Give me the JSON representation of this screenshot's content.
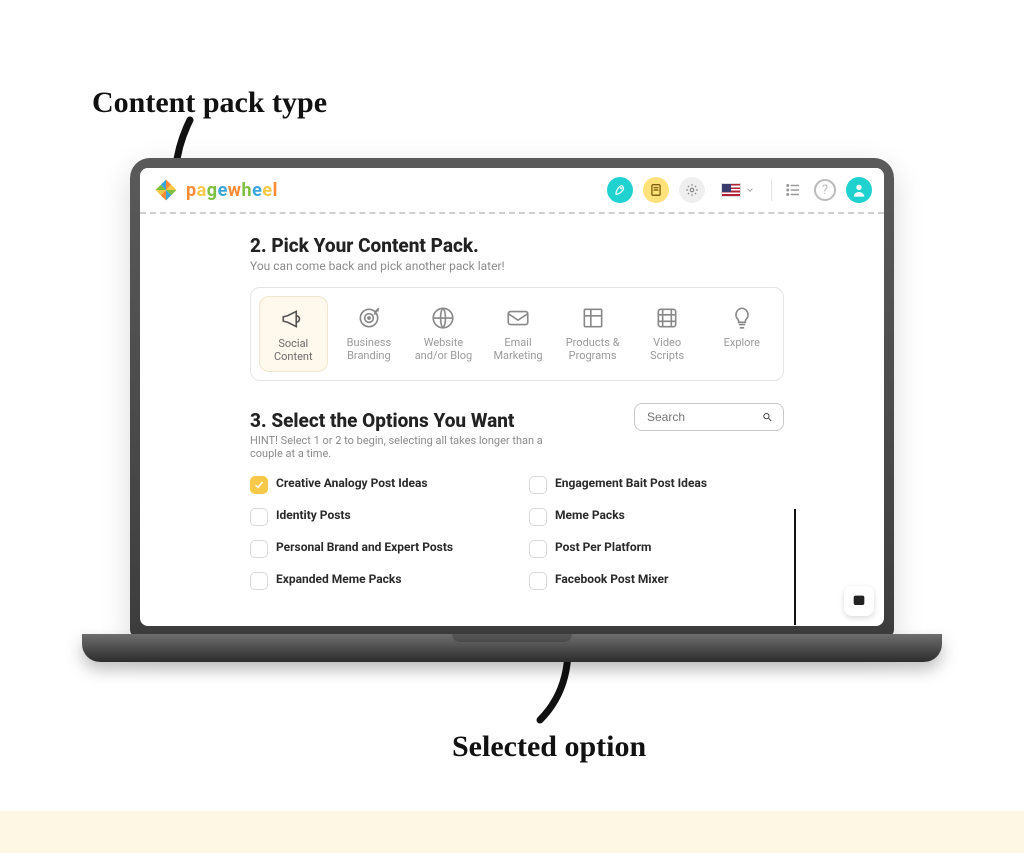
{
  "annotations": {
    "top": "Content pack type",
    "bottom": "Selected option"
  },
  "brand": {
    "name": "pagewheel",
    "letters": [
      "p",
      "a",
      "g",
      "e",
      "w",
      "h",
      "e",
      "e",
      "l"
    ]
  },
  "header": {
    "rocket": "rocket",
    "note": "note",
    "gear": "settings",
    "locale": "en-US",
    "list": "list",
    "help": "?",
    "avatar": "user"
  },
  "section2": {
    "title": "2. Pick Your Content Pack.",
    "subtitle": "You can come back and pick another pack later!",
    "packs": [
      {
        "label": "Social Content",
        "selected": true,
        "icon": "megaphone"
      },
      {
        "label": "Business Branding",
        "selected": false,
        "icon": "target"
      },
      {
        "label": "Website and/or Blog",
        "selected": false,
        "icon": "globe"
      },
      {
        "label": "Email Marketing",
        "selected": false,
        "icon": "envelope"
      },
      {
        "label": "Products & Programs",
        "selected": false,
        "icon": "box"
      },
      {
        "label": "Video Scripts",
        "selected": false,
        "icon": "film"
      },
      {
        "label": "Explore",
        "selected": false,
        "icon": "bulb"
      }
    ]
  },
  "section3": {
    "title": "3. Select the Options You Want",
    "hint": "HINT! Select 1 or 2 to begin, selecting all takes longer than a couple at a time.",
    "search_placeholder": "Search",
    "options": [
      {
        "label": "Creative Analogy Post Ideas",
        "checked": true
      },
      {
        "label": "Engagement Bait Post Ideas",
        "checked": false
      },
      {
        "label": "Identity Posts",
        "checked": false
      },
      {
        "label": "Meme Packs",
        "checked": false
      },
      {
        "label": "Personal Brand and Expert Posts",
        "checked": false
      },
      {
        "label": "Post Per Platform",
        "checked": false
      },
      {
        "label": "Expanded Meme Packs",
        "checked": false
      },
      {
        "label": "Facebook Post Mixer",
        "checked": false
      }
    ]
  }
}
